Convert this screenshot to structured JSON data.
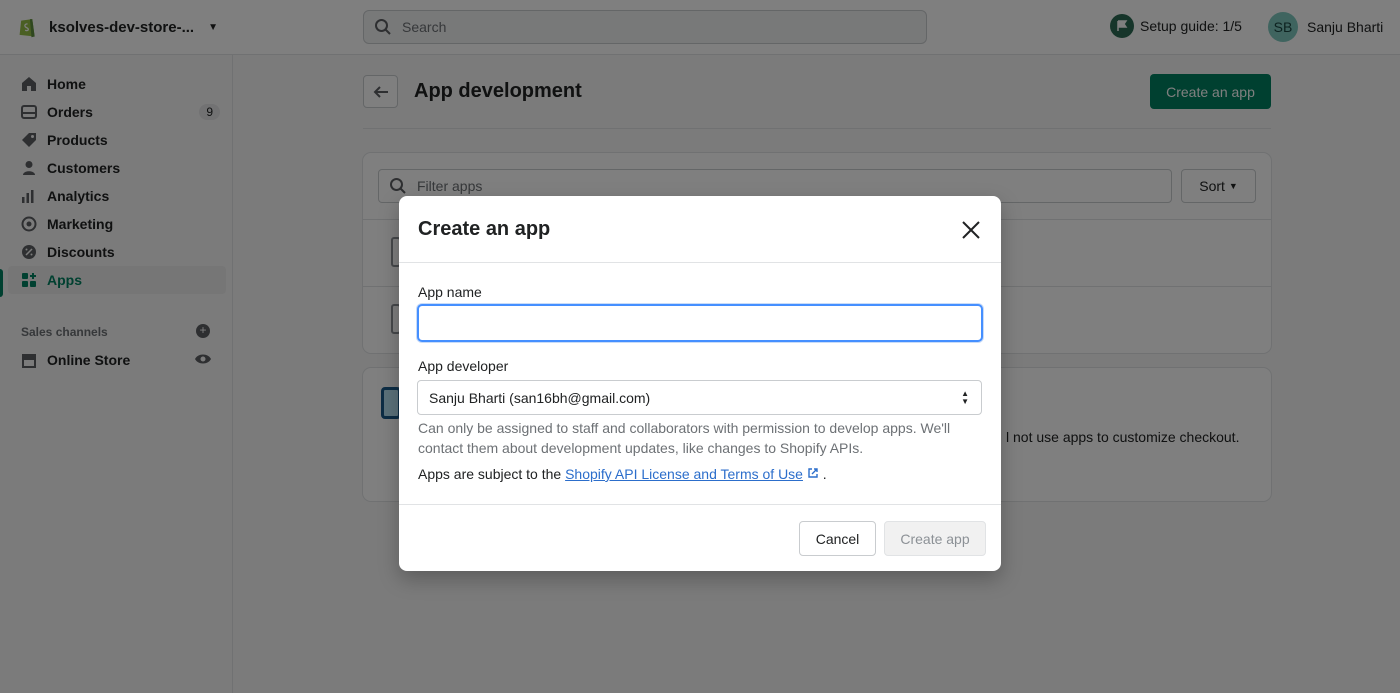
{
  "topbar": {
    "store_name": "ksolves-dev-store-...",
    "search_placeholder": "Search",
    "setup_guide": "Setup guide: 1/5",
    "user_initials": "SB",
    "user_name": "Sanju Bharti"
  },
  "sidebar": {
    "items": [
      {
        "label": "Home",
        "icon": "home-icon"
      },
      {
        "label": "Orders",
        "icon": "orders-icon",
        "badge": "9"
      },
      {
        "label": "Products",
        "icon": "tag-icon"
      },
      {
        "label": "Customers",
        "icon": "person-icon"
      },
      {
        "label": "Analytics",
        "icon": "bar-chart-icon"
      },
      {
        "label": "Marketing",
        "icon": "target-icon"
      },
      {
        "label": "Discounts",
        "icon": "discount-icon"
      },
      {
        "label": "Apps",
        "icon": "apps-icon",
        "active": true
      }
    ],
    "sales_channels_title": "Sales channels",
    "online_store": "Online Store"
  },
  "page": {
    "title": "App development",
    "create_button": "Create an app",
    "filter_placeholder": "Filter apps",
    "sort_label": "Sort",
    "card2_text": "l not use apps to customize checkout."
  },
  "modal": {
    "title": "Create an app",
    "app_name_label": "App name",
    "app_name_value": "",
    "app_developer_label": "App developer",
    "app_developer_value": "Sanju Bharti (san16bh@gmail.com)",
    "help_text": "Can only be assigned to staff and collaborators with permission to develop apps. We'll contact them about development updates, like changes to Shopify APIs.",
    "terms_prefix": "Apps are subject to the ",
    "terms_link": "Shopify API License and Terms of Use",
    "terms_suffix": ".",
    "cancel_label": "Cancel",
    "create_label": "Create app"
  },
  "colors": {
    "accent": "#008060",
    "focus": "#458fff",
    "link": "#2c6ecb"
  }
}
